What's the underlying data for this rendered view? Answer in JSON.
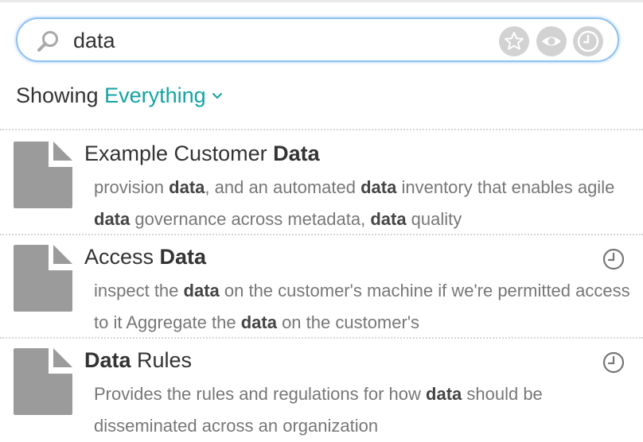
{
  "search": {
    "value": "data",
    "icons": [
      "search-icon",
      "star-icon",
      "eye-icon",
      "clock-icon"
    ]
  },
  "filter": {
    "showing_label": "Showing",
    "scope_value": "Everything",
    "accent_color": "#14a3a3"
  },
  "results": [
    {
      "title_parts": [
        {
          "text": "Example Customer ",
          "bold": false
        },
        {
          "text": "Data",
          "bold": true
        }
      ],
      "snippet_parts": [
        {
          "text": "provision ",
          "bold": false
        },
        {
          "text": "data",
          "bold": true
        },
        {
          "text": ", and an automated ",
          "bold": false
        },
        {
          "text": "data",
          "bold": true
        },
        {
          "text": " inventory that enables agile ",
          "bold": false
        },
        {
          "text": "data",
          "bold": true
        },
        {
          "text": " governance across metadata, ",
          "bold": false
        },
        {
          "text": "data",
          "bold": true
        },
        {
          "text": " quality",
          "bold": false
        }
      ],
      "recent": false,
      "icon": "document-icon"
    },
    {
      "title_parts": [
        {
          "text": "Access ",
          "bold": false
        },
        {
          "text": "Data",
          "bold": true
        }
      ],
      "snippet_parts": [
        {
          "text": "inspect the ",
          "bold": false
        },
        {
          "text": "data",
          "bold": true
        },
        {
          "text": " on the customer's machine if we're permitted access to it Aggregate the ",
          "bold": false
        },
        {
          "text": "data",
          "bold": true
        },
        {
          "text": " on the customer's",
          "bold": false
        }
      ],
      "recent": true,
      "icon": "document-icon"
    },
    {
      "title_parts": [
        {
          "text": "Data",
          "bold": true
        },
        {
          "text": " Rules",
          "bold": false
        }
      ],
      "snippet_parts": [
        {
          "text": "Provides the rules and regulations for how ",
          "bold": false
        },
        {
          "text": "data",
          "bold": true
        },
        {
          "text": " should be disseminated across an organization",
          "bold": false
        }
      ],
      "recent": true,
      "icon": "document-icon"
    }
  ]
}
